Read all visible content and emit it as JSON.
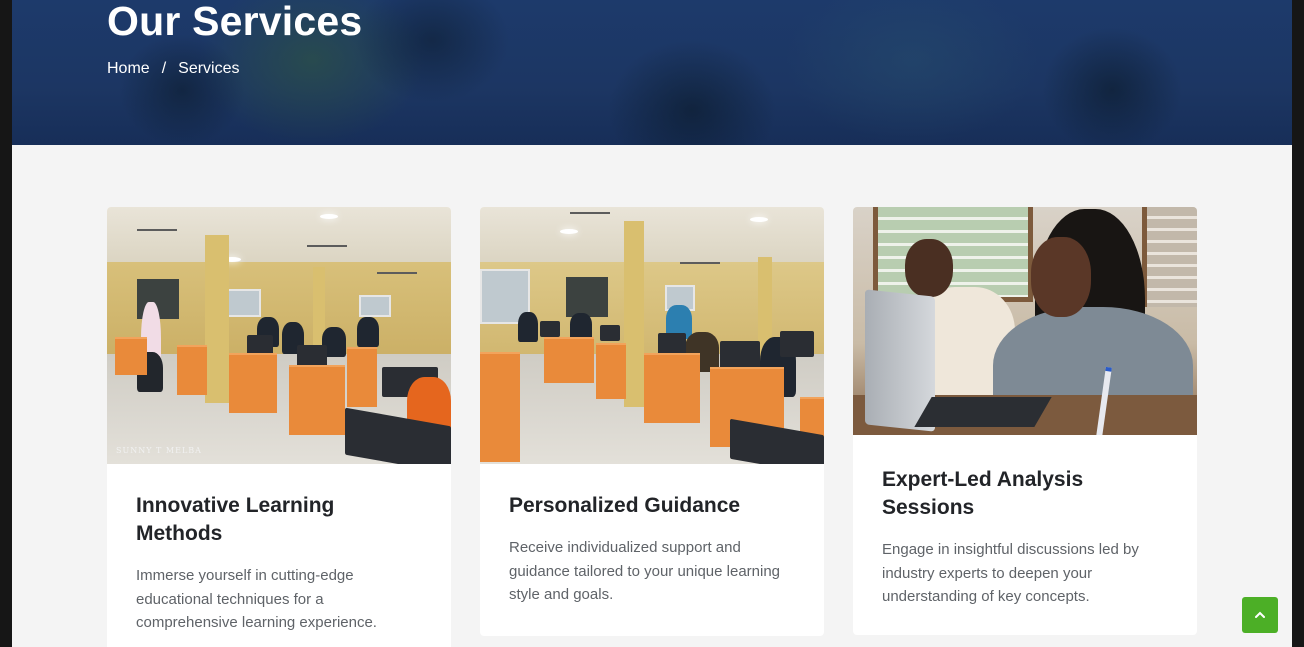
{
  "hero": {
    "title": "Our Services",
    "breadcrumb": {
      "home": "Home",
      "separator": "/",
      "current": "Services"
    }
  },
  "services": [
    {
      "title": "Innovative Learning Methods",
      "description": "Immerse yourself in cutting-edge educational techniques for a comprehensive learning experience.",
      "image_watermark": "SUNNY T MELBA"
    },
    {
      "title": "Personalized Guidance",
      "description": "Receive individualized support and guidance tailored to your unique learning style and goals."
    },
    {
      "title": "Expert-Led Analysis Sessions",
      "description": "Engage in insightful discussions led by industry experts to deepen your understanding of key concepts."
    }
  ],
  "back_to_top": {
    "icon": "chevron-up-icon",
    "color": "#4caf26"
  },
  "colors": {
    "hero_bg": "#1c3663",
    "page_bg": "#f4f4f4",
    "title_text": "#222428",
    "body_text": "#5f6368"
  }
}
